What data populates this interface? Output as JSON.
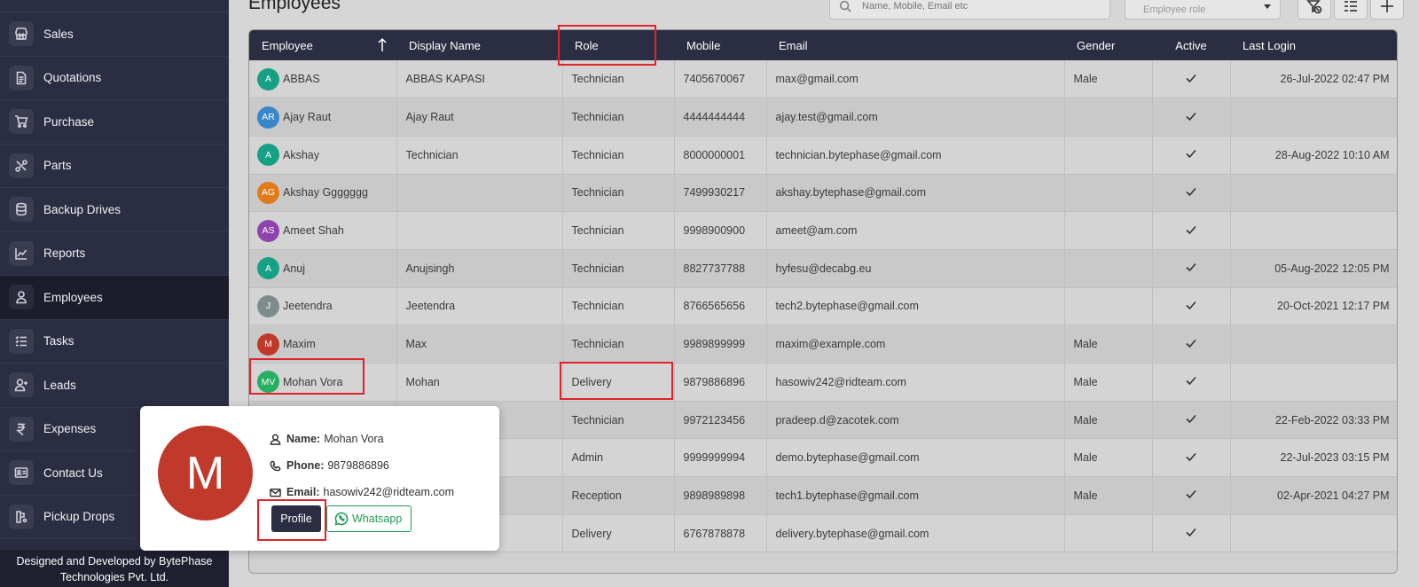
{
  "sidebar": {
    "items": [
      {
        "label": "Sales",
        "icon": "store-icon",
        "active": false
      },
      {
        "label": "Quotations",
        "icon": "document-icon",
        "active": false
      },
      {
        "label": "Purchase",
        "icon": "cart-icon",
        "active": false
      },
      {
        "label": "Parts",
        "icon": "tools-icon",
        "active": false
      },
      {
        "label": "Backup Drives",
        "icon": "database-icon",
        "active": false
      },
      {
        "label": "Reports",
        "icon": "chart-line-icon",
        "active": false
      },
      {
        "label": "Employees",
        "icon": "user-icon",
        "active": true
      },
      {
        "label": "Tasks",
        "icon": "task-list-icon",
        "active": false
      },
      {
        "label": "Leads",
        "icon": "user-plus-icon",
        "active": false
      },
      {
        "label": "Expenses",
        "icon": "rupee-icon",
        "active": false
      },
      {
        "label": "Contact Us",
        "icon": "contact-card-icon",
        "active": false
      },
      {
        "label": "Pickup Drops",
        "icon": "pickup-icon",
        "active": false
      }
    ],
    "footer": "Designed and Developed by BytePhase Technologies Pvt. Ltd."
  },
  "header": {
    "title": "Employees",
    "search_placeholder": "Name, Mobile, Email etc",
    "role_placeholder": "Employee role"
  },
  "table": {
    "columns": [
      "Employee",
      "Display Name",
      "Role",
      "Mobile",
      "Email",
      "Gender",
      "Active",
      "Last Login"
    ],
    "rows": [
      {
        "initials": "A",
        "color": "#16a085",
        "name": "ABBAS",
        "display": "ABBAS KAPASI",
        "role": "Technician",
        "mobile": "7405670067",
        "email": "max@gmail.com",
        "gender": "Male",
        "active": true,
        "last_login": "26-Jul-2022 02:47 PM"
      },
      {
        "initials": "AR",
        "color": "#3a86c8",
        "name": "Ajay Raut",
        "display": "Ajay Raut",
        "role": "Technician",
        "mobile": "4444444444",
        "email": "ajay.test@gmail.com",
        "gender": "",
        "active": true,
        "last_login": ""
      },
      {
        "initials": "A",
        "color": "#16a085",
        "name": "Akshay",
        "display": "Technician",
        "role": "Technician",
        "mobile": "8000000001",
        "email": "technician.bytephase@gmail.com",
        "gender": "",
        "active": true,
        "last_login": "28-Aug-2022 10:10 AM"
      },
      {
        "initials": "AG",
        "color": "#e07b1a",
        "name": "Akshay Ggggggg",
        "display": "",
        "role": "Technician",
        "mobile": "7499930217",
        "email": "akshay.bytephase@gmail.com",
        "gender": "",
        "active": true,
        "last_login": ""
      },
      {
        "initials": "AS",
        "color": "#8e44ad",
        "name": "Ameet Shah",
        "display": "",
        "role": "Technician",
        "mobile": "9998900900",
        "email": "ameet@am.com",
        "gender": "",
        "active": true,
        "last_login": ""
      },
      {
        "initials": "A",
        "color": "#16a085",
        "name": "Anuj",
        "display": "Anujsingh",
        "role": "Technician",
        "mobile": "8827737788",
        "email": "hyfesu@decabg.eu",
        "gender": "",
        "active": true,
        "last_login": "05-Aug-2022 12:05 PM"
      },
      {
        "initials": "J",
        "color": "#7f8c8d",
        "name": "Jeetendra",
        "display": "Jeetendra",
        "role": "Technician",
        "mobile": "8766565656",
        "email": "tech2.bytephase@gmail.com",
        "gender": "",
        "active": true,
        "last_login": "20-Oct-2021 12:17 PM"
      },
      {
        "initials": "M",
        "color": "#c0392b",
        "name": "Maxim",
        "display": "Max",
        "role": "Technician",
        "mobile": "9989899999",
        "email": "maxim@example.com",
        "gender": "Male",
        "active": true,
        "last_login": ""
      },
      {
        "initials": "MV",
        "color": "#27ae60",
        "name": "Mohan Vora",
        "display": "Mohan",
        "role": "Delivery",
        "mobile": "9879886896",
        "email": "hasowiv242@ridteam.com",
        "gender": "Male",
        "active": true,
        "last_login": ""
      },
      {
        "initials": "",
        "color": "#8e44ad",
        "name": "",
        "display": "",
        "role": "Technician",
        "mobile": "9972123456",
        "email": "pradeep.d@zacotek.com",
        "gender": "Male",
        "active": true,
        "last_login": "22-Feb-2022 03:33 PM"
      },
      {
        "initials": "",
        "color": "#8e44ad",
        "name": "",
        "display": "",
        "role": "Admin",
        "mobile": "9999999994",
        "email": "demo.bytephase@gmail.com",
        "gender": "Male",
        "active": true,
        "last_login": "22-Jul-2023 03:15 PM"
      },
      {
        "initials": "",
        "color": "#8e44ad",
        "name": "",
        "display": "",
        "role": "Reception",
        "mobile": "9898989898",
        "email": "tech1.bytephase@gmail.com",
        "gender": "Male",
        "active": true,
        "last_login": "02-Apr-2021 04:27 PM"
      },
      {
        "initials": "",
        "color": "#8e44ad",
        "name": "",
        "display": "",
        "role": "Delivery",
        "mobile": "6767878878",
        "email": "delivery.bytephase@gmail.com",
        "gender": "",
        "active": true,
        "last_login": ""
      }
    ]
  },
  "popover": {
    "initial": "M",
    "name_label": "Name:",
    "name": "Mohan Vora",
    "phone_label": "Phone:",
    "phone": "9879886896",
    "email_label": "Email:",
    "email": "hasowiv242@ridteam.com",
    "profile_label": "Profile",
    "whatsapp_label": "Whatsapp"
  }
}
